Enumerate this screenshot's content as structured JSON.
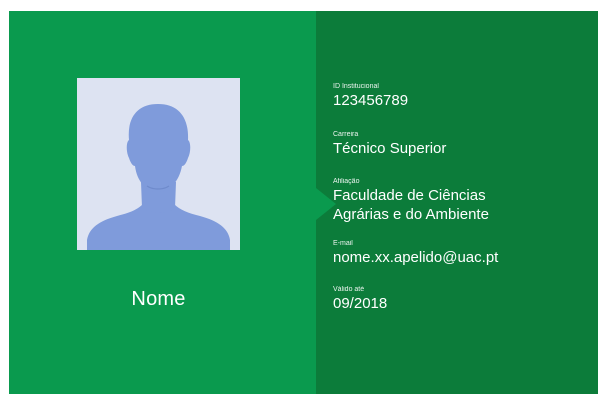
{
  "colors": {
    "left_panel": "#0a9a4e",
    "right_panel": "#0c7c3a",
    "photo_background": "#dde3f2",
    "silhouette": "#7f9bdb"
  },
  "photo": {
    "icon": "person-silhouette-icon"
  },
  "name_label": "Nome",
  "fields": {
    "id": {
      "caption": "ID Institucional",
      "value": "123456789"
    },
    "career": {
      "caption": "Carreira",
      "value": "Técnico Superior"
    },
    "affiliation": {
      "caption": "Afiliação",
      "value_lines": [
        "Faculdade de Ciências",
        "Agrárias e do Ambiente"
      ]
    },
    "email": {
      "caption": "E-mail",
      "value": "nome.xx.apelido@uac.pt"
    },
    "valid_until": {
      "caption": "Válido até",
      "value": "09/2018"
    }
  }
}
